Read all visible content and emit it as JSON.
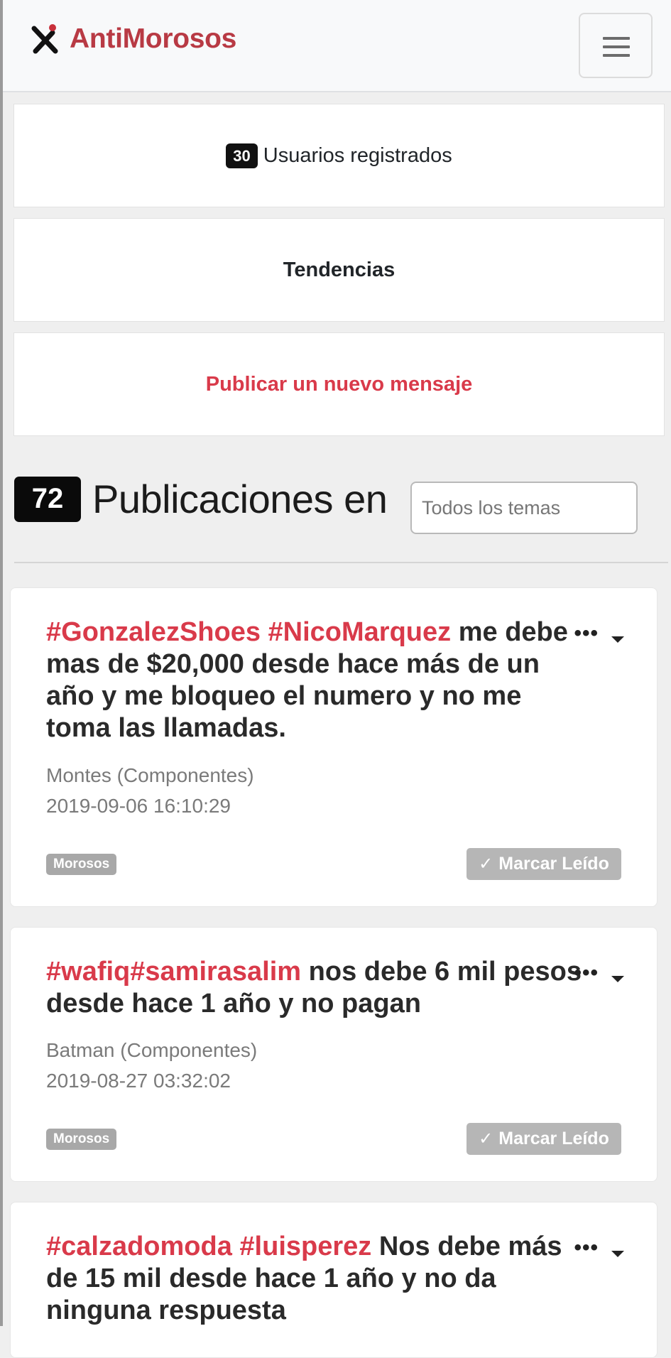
{
  "navbar": {
    "brand_name": "AntiMorosos",
    "menu_icon": "hamburger-icon",
    "logo_icon": "x-runner-logo"
  },
  "panels": {
    "users_count": "30",
    "users_label": "Usuarios registrados",
    "trends_label": "Tendencias",
    "publish_label": "Publicar un nuevo mensaje"
  },
  "feed": {
    "count": "72",
    "title": "Publicaciones en",
    "topic_placeholder": "Todos los temas"
  },
  "posts": [
    {
      "hashtags": "#GonzalezShoes #NicoMarquez",
      "text": " me debe mas de $20,000 desde hace más de un año y me bloqueo el numero y no me toma las llamadas.",
      "author": "Montes (Componentes)",
      "date": "2019-09-06 16:10:29",
      "tag": "Morosos",
      "action": "Marcar Leído"
    },
    {
      "hashtags": "#wafiq#samirasalim",
      "text": " nos debe 6 mil pesos desde hace 1 año y no pagan",
      "author": "Batman (Componentes)",
      "date": "2019-08-27 03:32:02",
      "tag": "Morosos",
      "action": "Marcar Leído"
    },
    {
      "hashtags": "#calzadomoda #luisperez",
      "text": " Nos debe más de 15 mil desde hace 1 año y no da ninguna respuesta"
    }
  ],
  "colors": {
    "brand": "#b83a44",
    "accent": "#d93a4a",
    "badge": "#111111",
    "muted_button": "#b6b6b6"
  }
}
